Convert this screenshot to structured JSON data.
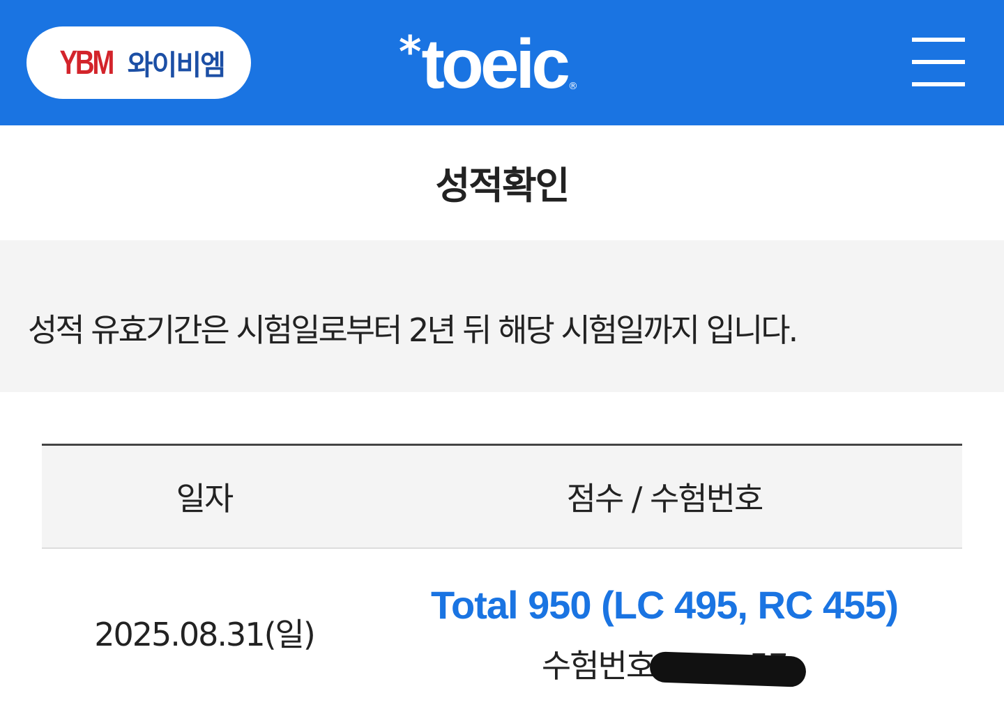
{
  "header": {
    "ybm_logo_mark": "YBM",
    "ybm_logo_text": "와이비엠",
    "toeic_star": "*",
    "toeic_logo_text": "toeic",
    "toeic_reg": "®",
    "brand_color": "#1a74e2"
  },
  "page": {
    "title": "성적확인",
    "notice": "성적 유효기간은 시험일로부터 2년 뒤 해당 시험일까지 입니다."
  },
  "table": {
    "columns": [
      "일자",
      "점수 / 수험번호"
    ],
    "rows": [
      {
        "date": "2025.08.31(일)",
        "score": "Total 950 (LC 495, RC 455)",
        "exam_label": "수험번호",
        "exam_number_visible": "57"
      }
    ]
  },
  "icons": {
    "menu": "hamburger-menu-icon"
  },
  "colors": {
    "score_text": "#1a74e2",
    "ybm_red": "#d3242b",
    "ybm_blue": "#1c4fa5"
  }
}
